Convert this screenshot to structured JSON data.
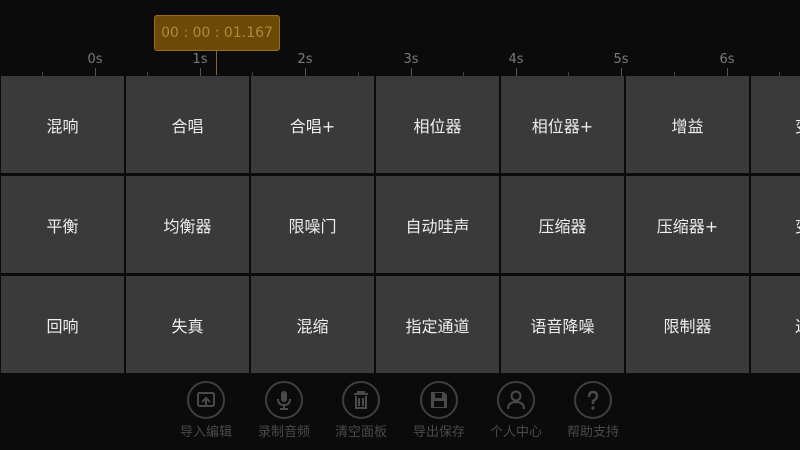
{
  "timer": {
    "value": "00 : 00 : 01.167"
  },
  "ruler": {
    "labels": [
      "0s",
      "1s",
      "2s",
      "3s",
      "4s",
      "5s",
      "6s"
    ]
  },
  "effects": {
    "row1": [
      "混响",
      "合唱",
      "合唱+",
      "相位器",
      "相位器+",
      "增益",
      "变"
    ],
    "row2": [
      "平衡",
      "均衡器",
      "限噪门",
      "自动哇声",
      "压缩器",
      "压缩器+",
      "变"
    ],
    "row3": [
      "回响",
      "失真",
      "混缩",
      "指定通道",
      "语音降噪",
      "限制器",
      "过"
    ]
  },
  "toolbar": {
    "items": [
      {
        "label": "导入编辑",
        "icon": "import-edit-icon"
      },
      {
        "label": "录制音频",
        "icon": "microphone-icon"
      },
      {
        "label": "清空面板",
        "icon": "trash-icon"
      },
      {
        "label": "导出保存",
        "icon": "save-icon"
      },
      {
        "label": "个人中心",
        "icon": "user-icon"
      },
      {
        "label": "帮助支持",
        "icon": "help-icon"
      }
    ]
  },
  "colors": {
    "background": "#0b0b0b",
    "cell": "#3a3a3a",
    "badge": "#6b4a07",
    "badge_text": "#b0893a"
  }
}
